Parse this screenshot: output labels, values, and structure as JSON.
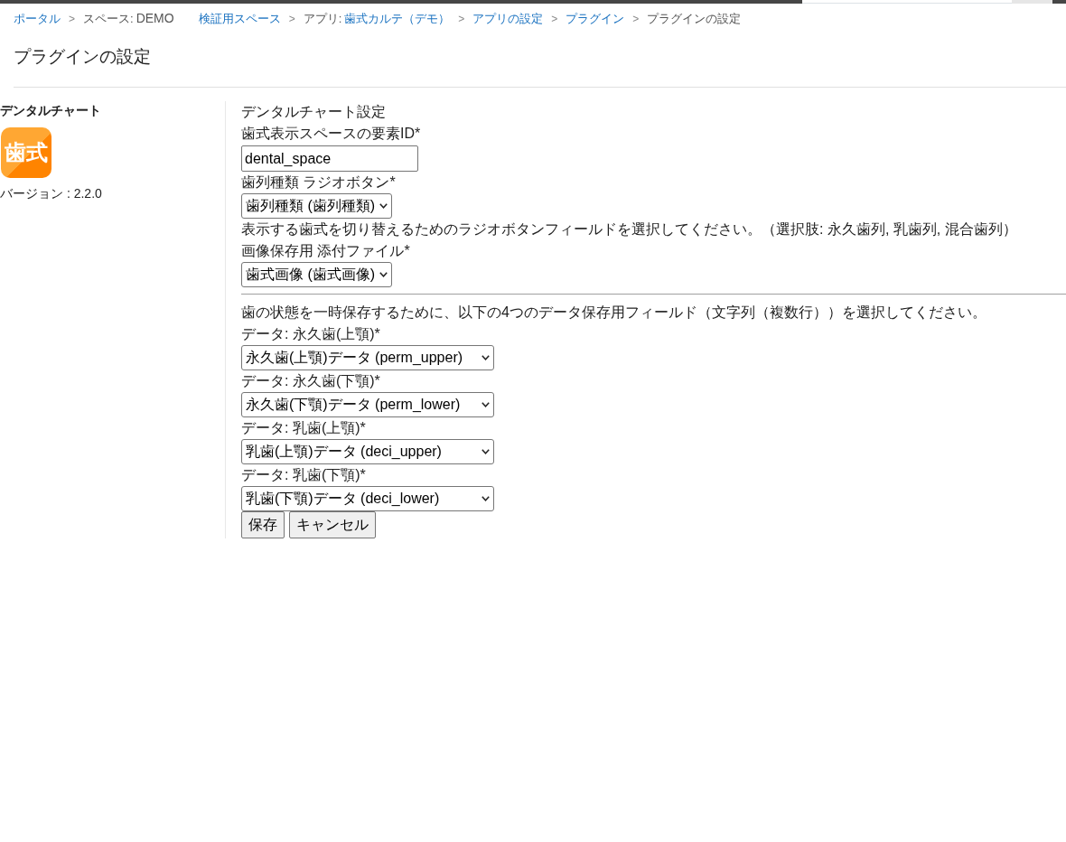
{
  "breadcrumb": [
    {
      "parts": [
        {
          "kind": "link",
          "text": "ポータル"
        }
      ]
    },
    {
      "separator": ">",
      "parts": [
        {
          "kind": "text",
          "text": "スペース:"
        },
        {
          "kind": "name",
          "text": "DEMO"
        },
        {
          "kind": "link",
          "text": "検証用スペース"
        }
      ]
    },
    {
      "separator": ">",
      "parts": [
        {
          "kind": "text",
          "text": "アプリ:"
        },
        {
          "kind": "link",
          "text": "歯式カルテ（デモ）"
        }
      ]
    },
    {
      "separator": ">",
      "parts": [
        {
          "kind": "link",
          "text": "アプリの設定"
        }
      ]
    },
    {
      "separator": ">",
      "parts": [
        {
          "kind": "link",
          "text": "プラグイン"
        }
      ]
    },
    {
      "separator": ">",
      "parts": [
        {
          "kind": "text",
          "text": "プラグインの設定"
        }
      ]
    }
  ],
  "page_title": "プラグインの設定",
  "plugin": {
    "name": "デンタルチャート",
    "logo_text": "歯式",
    "version": "バージョン : 2.2.0"
  },
  "form": {
    "title": "デンタルチャート設定",
    "sections": [
      {
        "items": [
          {
            "kind": "text_input",
            "label": "歯式表示スペースの要素ID*",
            "value": "dental_space"
          },
          {
            "kind": "select",
            "label": "歯列種類 ラジオボタン*",
            "value": "歯列種類 (歯列種類)"
          },
          {
            "kind": "note",
            "text": "表示する歯式を切り替えるためのラジオボタンフィールドを選択してください。（選択肢: 永久歯列, 乳歯列, 混合歯列）"
          },
          {
            "kind": "select",
            "label": "画像保存用 添付ファイル*",
            "value": "歯式画像 (歯式画像)"
          }
        ]
      },
      {
        "items": [
          {
            "kind": "note",
            "text": "歯の状態を一時保存するために、以下の4つのデータ保存用フィールド（文字列（複数行））を選択してください。"
          },
          {
            "kind": "select",
            "label": "データ: 永久歯(上顎)*",
            "value": "永久歯(上顎)データ (perm_upper)"
          },
          {
            "kind": "select",
            "label": "データ: 永久歯(下顎)*",
            "value": "永久歯(下顎)データ (perm_lower)"
          },
          {
            "kind": "select",
            "label": "データ: 乳歯(上顎)*",
            "value": "乳歯(上顎)データ (deci_upper)"
          },
          {
            "kind": "select",
            "label": "データ: 乳歯(下顎)*",
            "value": "乳歯(下顎)データ (deci_lower)"
          }
        ]
      }
    ],
    "buttons": [
      {
        "label": "保存"
      },
      {
        "label": "キャンセル"
      }
    ]
  }
}
